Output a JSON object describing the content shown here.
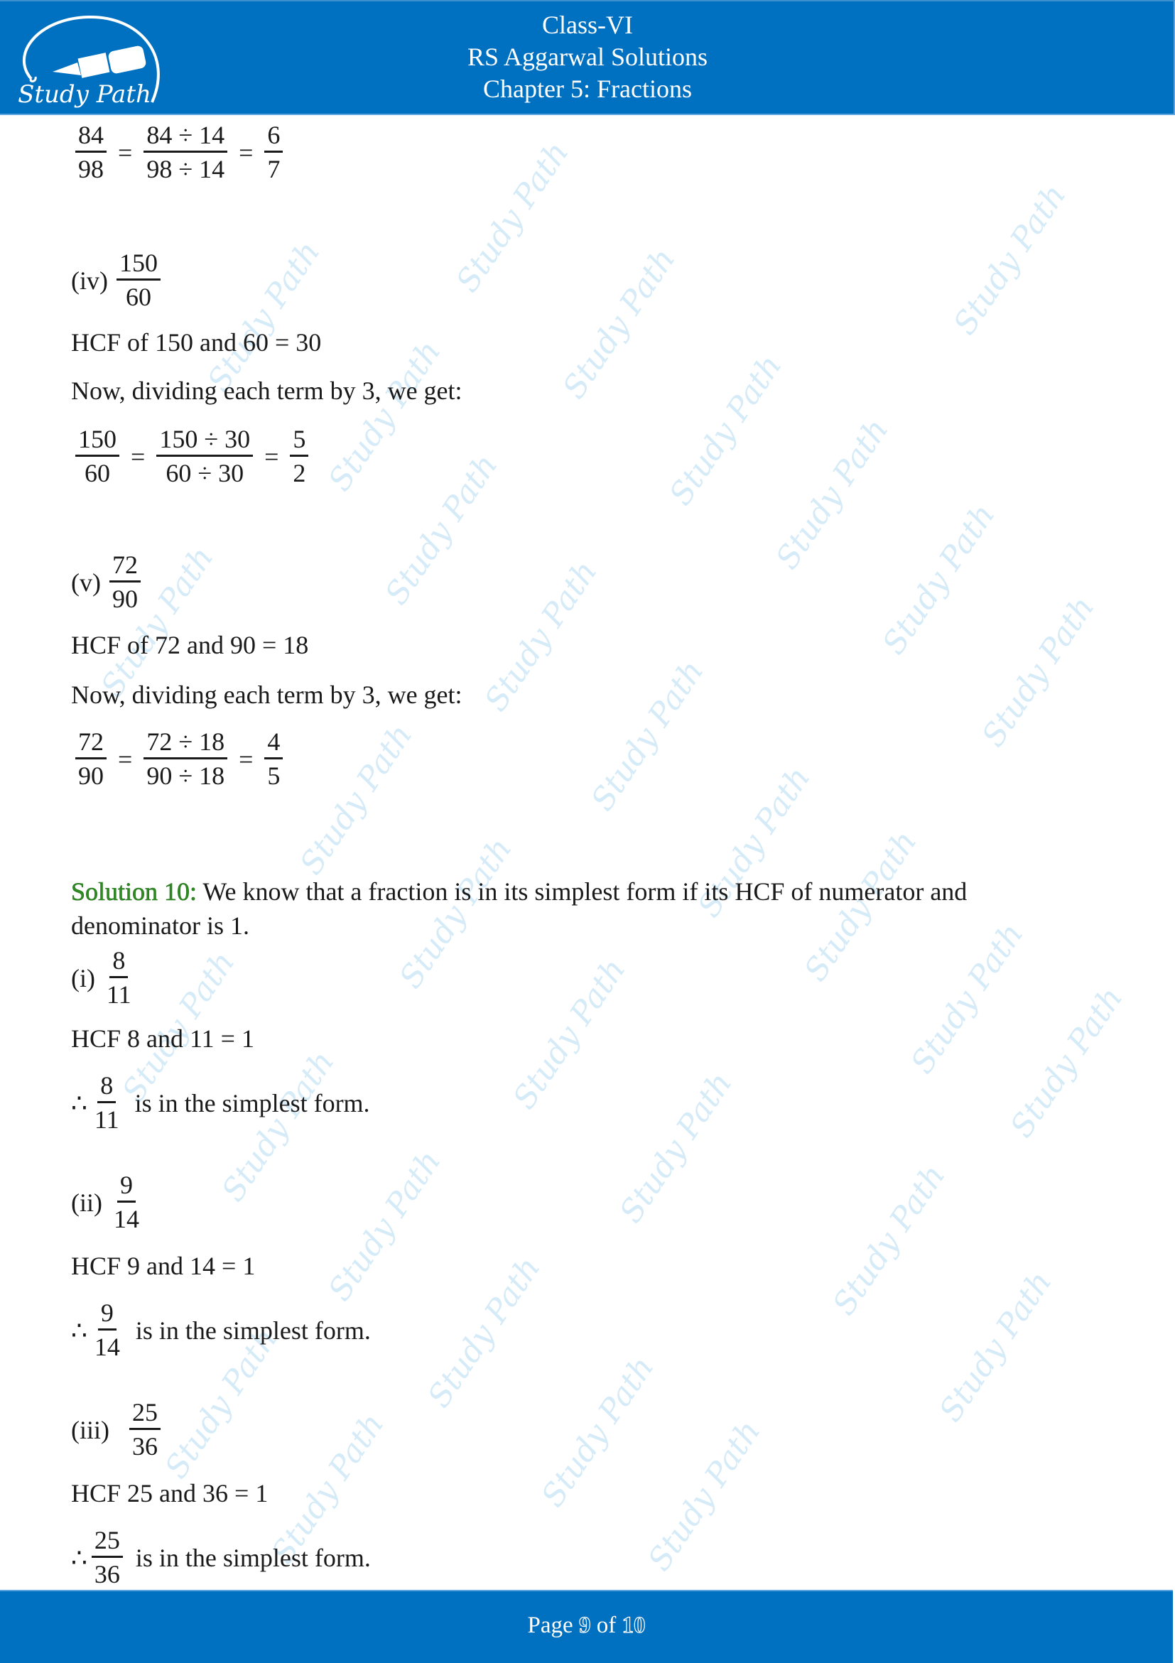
{
  "header": {
    "logo_text": "Study Path",
    "line1": "Class-VI",
    "line2": "RS Aggarwal Solutions",
    "line3": "Chapter 5: Fractions",
    "color": "#0070C0"
  },
  "watermark": "Study Path",
  "content": {
    "iii_result": {
      "left": {
        "num": "84",
        "den": "98"
      },
      "mid": {
        "num": "84 ÷ 14",
        "den": "98 ÷ 14"
      },
      "right": {
        "num": "6",
        "den": "7"
      },
      "eq": "="
    },
    "iv": {
      "label": "(iv)",
      "frac": {
        "num": "150",
        "den": "60"
      },
      "hcf": "HCF of 150 and 60 = 30",
      "now": "Now, dividing each term by 3, we get:",
      "left": {
        "num": "150",
        "den": "60"
      },
      "mid": {
        "num": "150 ÷ 30",
        "den": "60 ÷ 30"
      },
      "right": {
        "num": "5",
        "den": "2"
      },
      "eq": "="
    },
    "v": {
      "label": "(v)",
      "frac": {
        "num": "72",
        "den": "90"
      },
      "hcf": "HCF of 72 and 90 = 18",
      "now": "Now, dividing each term by 3, we get:",
      "left": {
        "num": "72",
        "den": "90"
      },
      "mid": {
        "num": "72 ÷ 18",
        "den": "90 ÷ 18"
      },
      "right": {
        "num": "4",
        "den": "5"
      },
      "eq": "="
    },
    "solution10": {
      "heading": "Solution 10:",
      "heading_color": "#2e8b22",
      "text_line1": " We know that a fraction is in its simplest form if its HCF of numerator and",
      "text_line2": "denominator is 1.",
      "items": [
        {
          "label": "(i)",
          "frac": {
            "num": "8",
            "den": "11"
          },
          "hcf": "HCF  8 and 11 = 1",
          "therefore": "∴",
          "conclusion": "is in the simplest form."
        },
        {
          "label": "(ii)",
          "frac": {
            "num": "9",
            "den": "14"
          },
          "hcf": "HCF  9 and 14 = 1",
          "therefore": "∴",
          "conclusion": "is in the simplest form."
        },
        {
          "label": "(iii)",
          "frac": {
            "num": "25",
            "den": "36"
          },
          "hcf": "HCF  25 and 36 = 1",
          "therefore": "∴",
          "conclusion": "is in the simplest form."
        }
      ]
    }
  },
  "footer": {
    "page_prefix": "Page ",
    "page_current": "9",
    "page_sep": " of ",
    "page_total": "10"
  }
}
